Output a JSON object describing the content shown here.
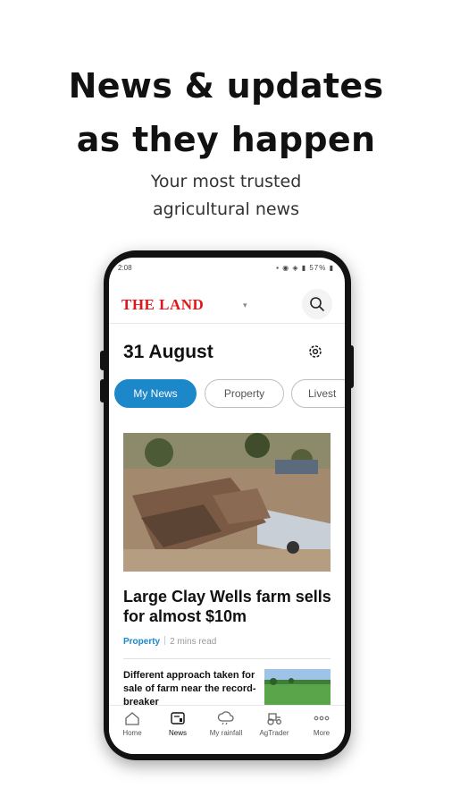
{
  "promo": {
    "headline_line1": "News & updates",
    "headline_line2": "as they happen",
    "sub_line1": "Your most trusted",
    "sub_line2": "agricultural news"
  },
  "status_bar": {
    "time": "2:08",
    "battery": "57%"
  },
  "app": {
    "logo": "THE LAND",
    "logo_caret": "▾",
    "date": "31 August",
    "tabs": [
      {
        "label": "My News",
        "active": true
      },
      {
        "label": "Property",
        "active": false
      },
      {
        "label": "Livest",
        "active": false
      }
    ],
    "articles": [
      {
        "title": "Large Clay Wells farm sells for almost $10m",
        "category": "Property",
        "read_time": "2 mins read"
      },
      {
        "title": "Different approach taken for sale of farm near the record-breaker"
      }
    ],
    "bottom_nav": [
      {
        "label": "Home",
        "icon": "home-icon"
      },
      {
        "label": "News",
        "icon": "news-icon"
      },
      {
        "label": "My rainfall",
        "icon": "rain-cloud-icon"
      },
      {
        "label": "AgTrader",
        "icon": "tractor-icon"
      },
      {
        "label": "More",
        "icon": "more-dots-icon"
      }
    ]
  },
  "colors": {
    "accent": "#1c87c9",
    "brand_red": "#e0161b"
  }
}
